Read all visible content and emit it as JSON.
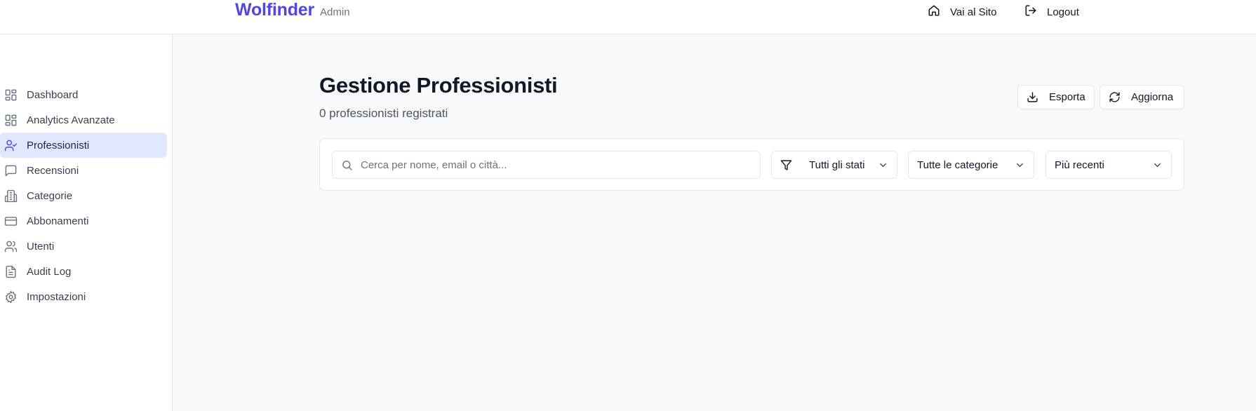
{
  "header": {
    "brand": "Wolfinder",
    "brand_sub": "Admin",
    "site_link": "Vai al Sito",
    "logout": "Logout"
  },
  "sidebar": {
    "items": [
      {
        "label": "Dashboard",
        "icon": "dashboard-grid-icon"
      },
      {
        "label": "Analytics Avanzate",
        "icon": "analytics-grid-icon"
      },
      {
        "label": "Professionisti",
        "icon": "user-check-icon",
        "active": true
      },
      {
        "label": "Recensioni",
        "icon": "message-square-icon"
      },
      {
        "label": "Categorie",
        "icon": "building-icon"
      },
      {
        "label": "Abbonamenti",
        "icon": "credit-card-icon"
      },
      {
        "label": "Utenti",
        "icon": "users-icon"
      },
      {
        "label": "Audit Log",
        "icon": "file-text-icon"
      },
      {
        "label": "Impostazioni",
        "icon": "settings-icon"
      }
    ]
  },
  "main": {
    "title": "Gestione Professionisti",
    "subtitle": "0 professionisti registrati",
    "export_label": "Esporta",
    "refresh_label": "Aggiorna"
  },
  "filters": {
    "search_placeholder": "Cerca per nome, email o città...",
    "search_value": "",
    "status_select": "Tutti gli stati",
    "category_select": "Tutte le categorie",
    "sort_select": "Più recenti"
  },
  "colors": {
    "brand": "#4f46e5",
    "active_nav_bg": "#e0e7ff",
    "page_bg": "#f8f9fb"
  }
}
